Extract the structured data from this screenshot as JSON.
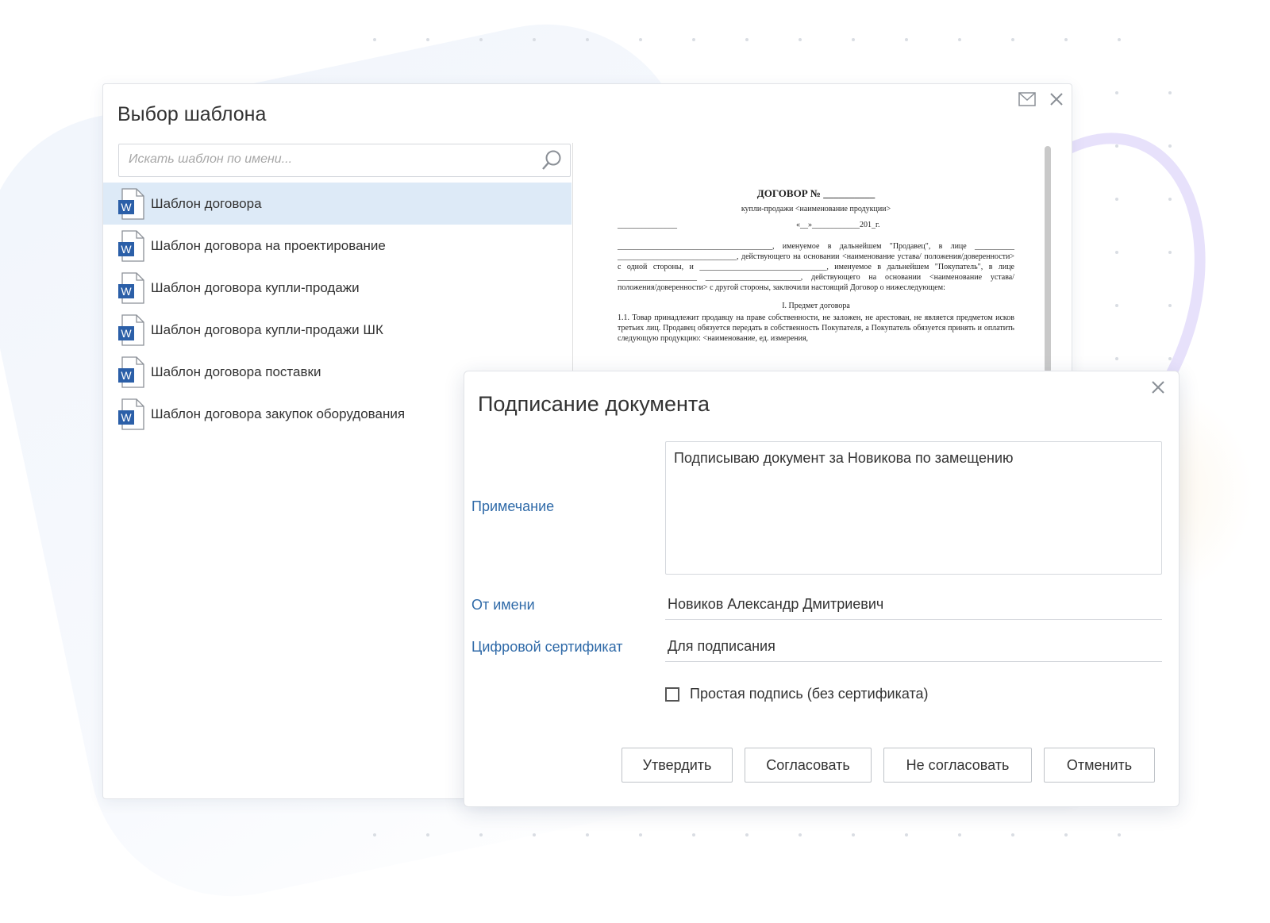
{
  "template_window": {
    "title": "Выбор шаблона",
    "search": {
      "placeholder": "Искать шаблон по имени..."
    },
    "templates": [
      {
        "label": "Шаблон договора",
        "selected": true
      },
      {
        "label": "Шаблон договора на проектирование",
        "selected": false
      },
      {
        "label": "Шаблон договора купли-продажи",
        "selected": false
      },
      {
        "label": "Шаблон договора купли-продажи ШК",
        "selected": false
      },
      {
        "label": "Шаблон договора поставки",
        "selected": false
      },
      {
        "label": "Шаблон договора закупок оборудования",
        "selected": false
      }
    ],
    "word_icon_letter": "W",
    "preview": {
      "title": "ДОГОВОР № __________",
      "subtitle": "купли-продажи <наименование продукции>",
      "date_line": "_______________                                                            «__»____________201_г.",
      "paragraphs": [
        "_______________________________________, именуемое в дальнейшем \"Продавец\", в лице __________ ______________________________, действующего на основании <наименование устава/ положения/доверенности> с одной стороны, и ________________________________, именуемое в дальнейшем \"Покупатель\", в лице ____________________ ________________________, действующего на основании <наименование устава/ положения/доверенности> с другой стороны, заключили настоящий Договор о нижеследующем:",
        "I. Предмет договора",
        "1.1. Товар принадлежит продавцу на праве собственности, не заложен, не арестован, не является предметом исков третьих лиц. Продавец обязуется передать в собственность Покупателя, а Покупатель обязуется принять и оплатить следующую продукцию: <наименование, ед. измерения,"
      ]
    }
  },
  "sign_dialog": {
    "title": "Подписание документа",
    "note_label": "Примечание",
    "note_value": "Подписываю документ за Новикова по замещению",
    "from_label": "От имени",
    "from_value": "Новиков Александр Дмитриевич",
    "cert_label": "Цифровой сертификат",
    "cert_value": "Для подписания",
    "simple_sign_label": "Простая подпись (без сертификата)",
    "simple_sign_checked": false,
    "buttons": {
      "approve": "Утвердить",
      "agree": "Согласовать",
      "disagree": "Не согласовать",
      "cancel": "Отменить"
    }
  },
  "colors": {
    "accent_label": "#2f6aa8",
    "selected_row": "#ddeaf7",
    "word_blue": "#2b5fa8"
  }
}
